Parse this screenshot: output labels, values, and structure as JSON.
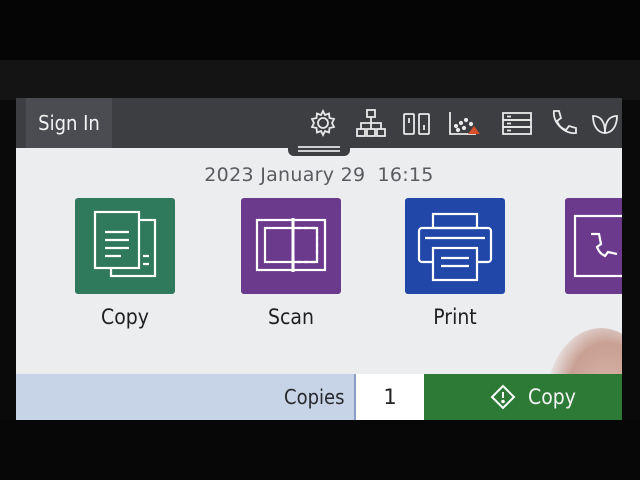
{
  "topbar": {
    "sign_in_label": "Sign In",
    "status_icons": [
      "gear-icon",
      "network-icon",
      "wifi-direct-icon",
      "ink-levels-icon",
      "tray-icon",
      "phone-icon",
      "eco-leaf-icon"
    ]
  },
  "status": {
    "date": "2023 January 29",
    "time": "16:15"
  },
  "apps": [
    {
      "label": "Copy",
      "icon": "copy-icon",
      "color": "#2f7a5c"
    },
    {
      "label": "Scan",
      "icon": "scan-icon",
      "color": "#6b3a8c"
    },
    {
      "label": "Print",
      "icon": "print-icon",
      "color": "#2148a8"
    },
    {
      "label": "",
      "icon": "fax-icon",
      "color": "#6b3a8c"
    }
  ],
  "bottom": {
    "copies_label": "Copies",
    "copies_value": "1",
    "action_label": "Copy",
    "action_color": "#2c7a35"
  }
}
